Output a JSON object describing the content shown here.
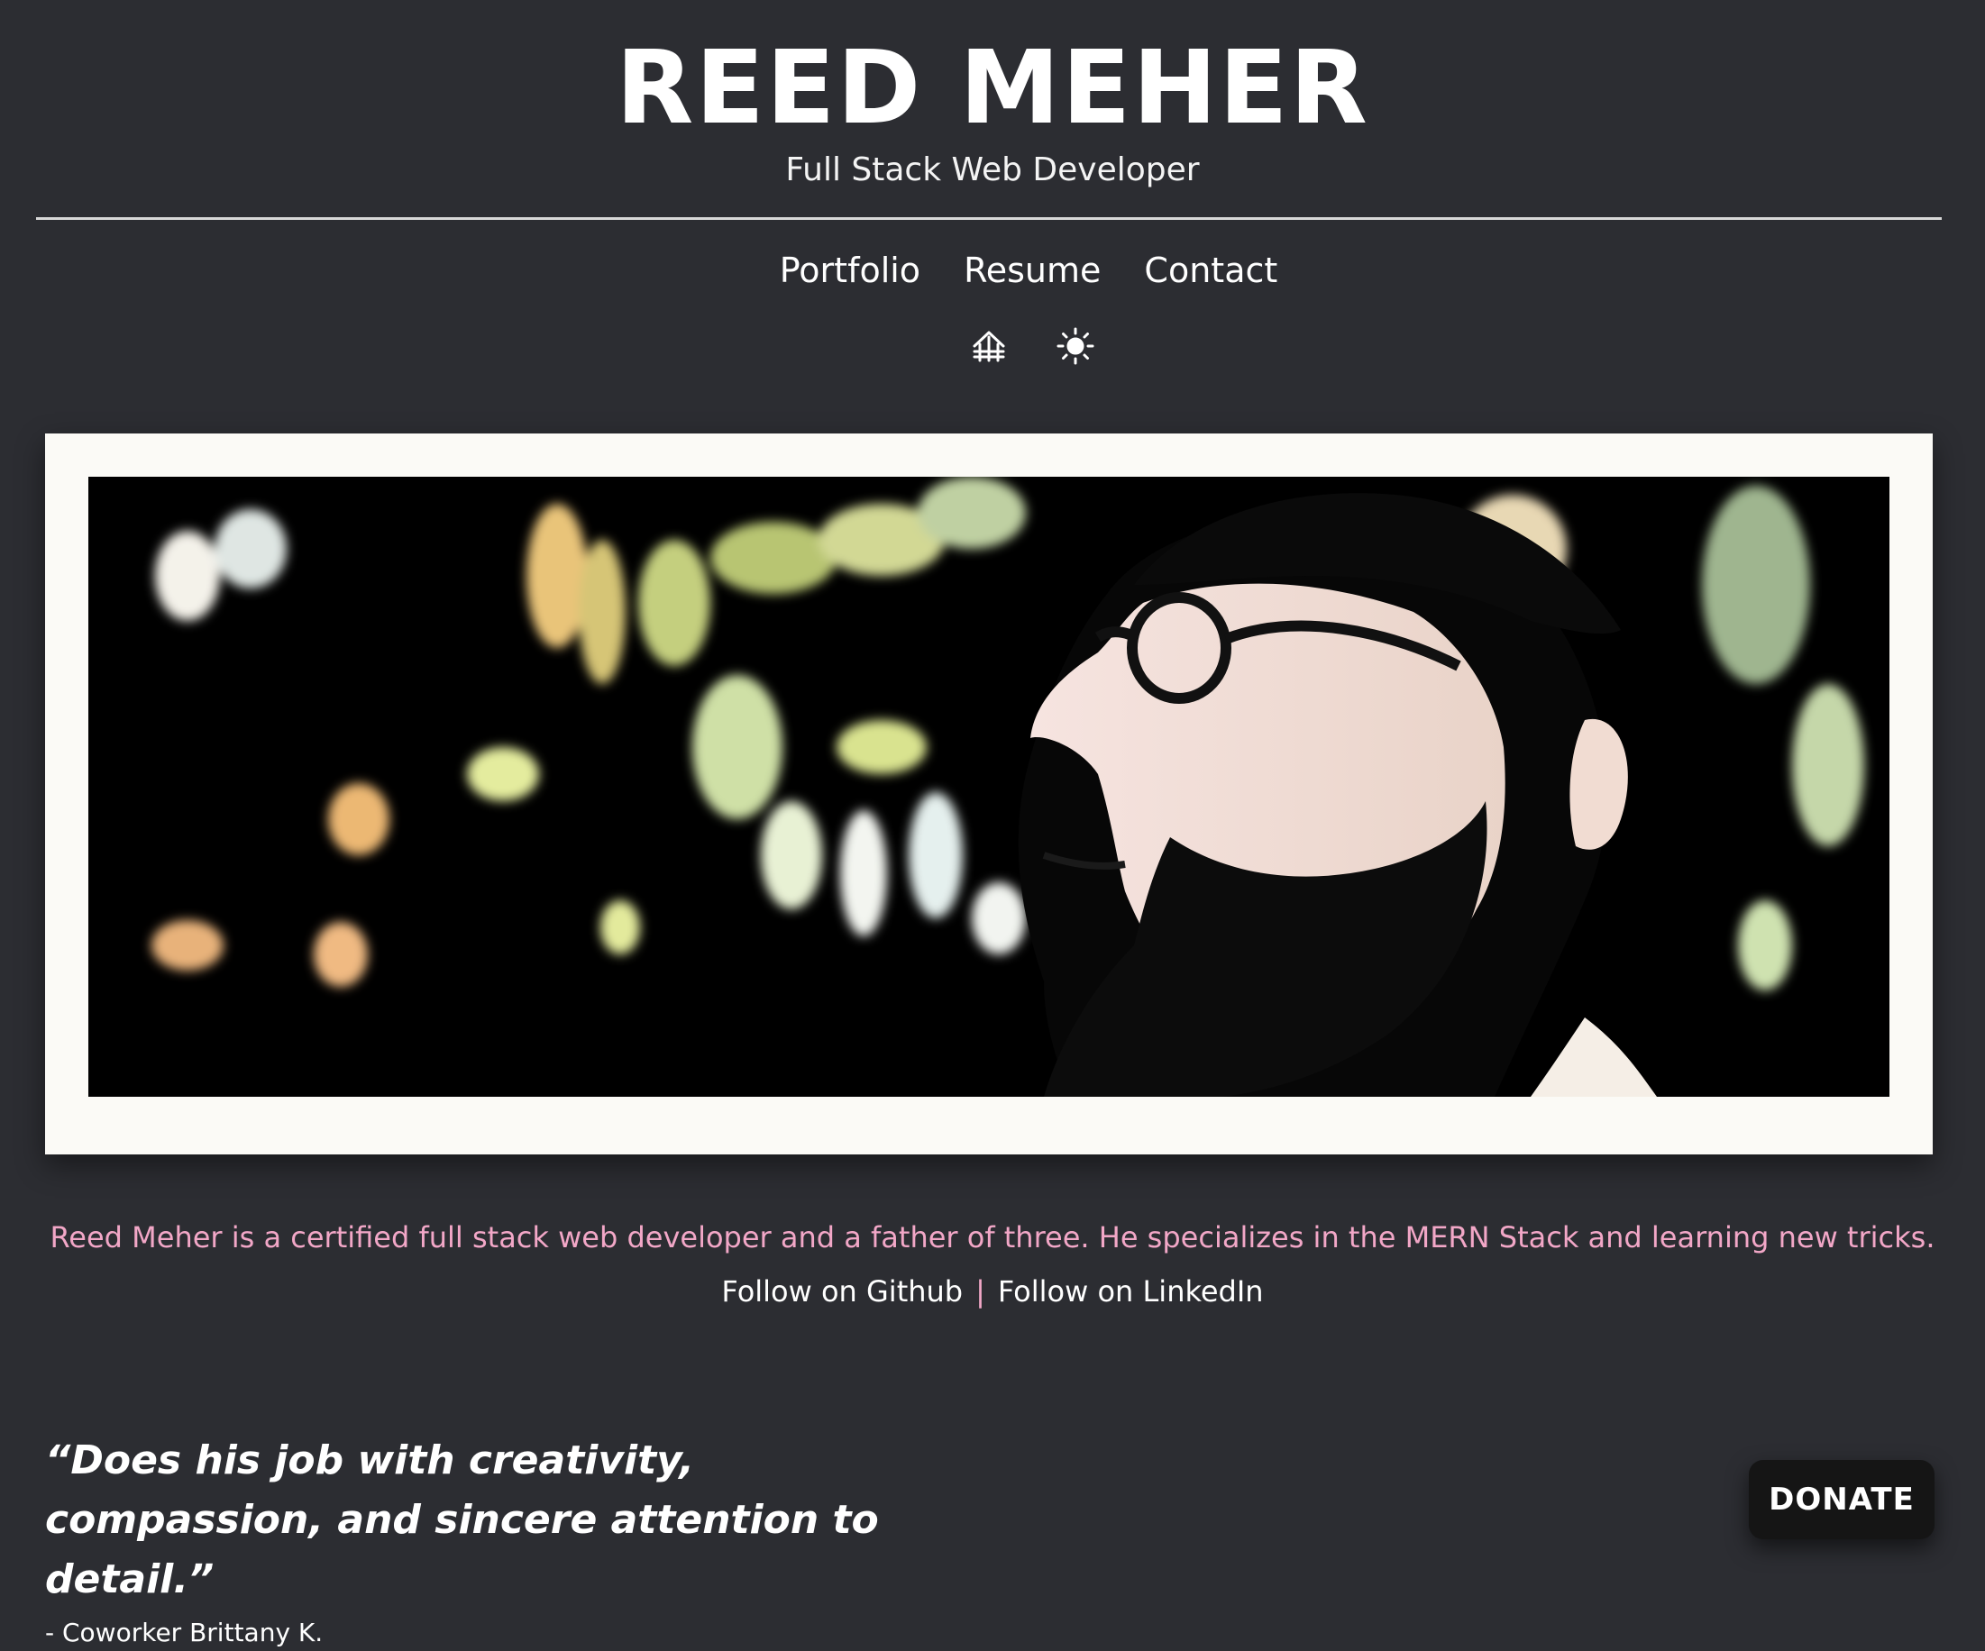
{
  "header": {
    "title": "REED MEHER",
    "subtitle": "Full Stack Web Developer"
  },
  "nav": {
    "items": [
      {
        "label": "Portfolio"
      },
      {
        "label": "Resume"
      },
      {
        "label": "Contact"
      }
    ]
  },
  "icons": {
    "home": "home-icon",
    "theme": "sun-icon"
  },
  "hero": {
    "image": "profile-photo",
    "description": "high-contrast side profile portrait with glasses against dark foliage"
  },
  "bio": {
    "text": "Reed Meher is a certified full stack web developer and a father of three. He specializes in the MERN Stack and learning new tricks."
  },
  "links": {
    "github": "Follow on Github",
    "separator": "|",
    "linkedin": "Follow on LinkedIn"
  },
  "testimonial": {
    "quote": "“Does his job with creativity, compassion, and sincere attention to detail.”",
    "author": "- Coworker Brittany K."
  },
  "donate": {
    "label": "DONATE"
  },
  "colors": {
    "background": "#2c2d32",
    "accent_pink": "#f2a7c7",
    "frame": "#fbfaf6",
    "button": "#151515"
  }
}
